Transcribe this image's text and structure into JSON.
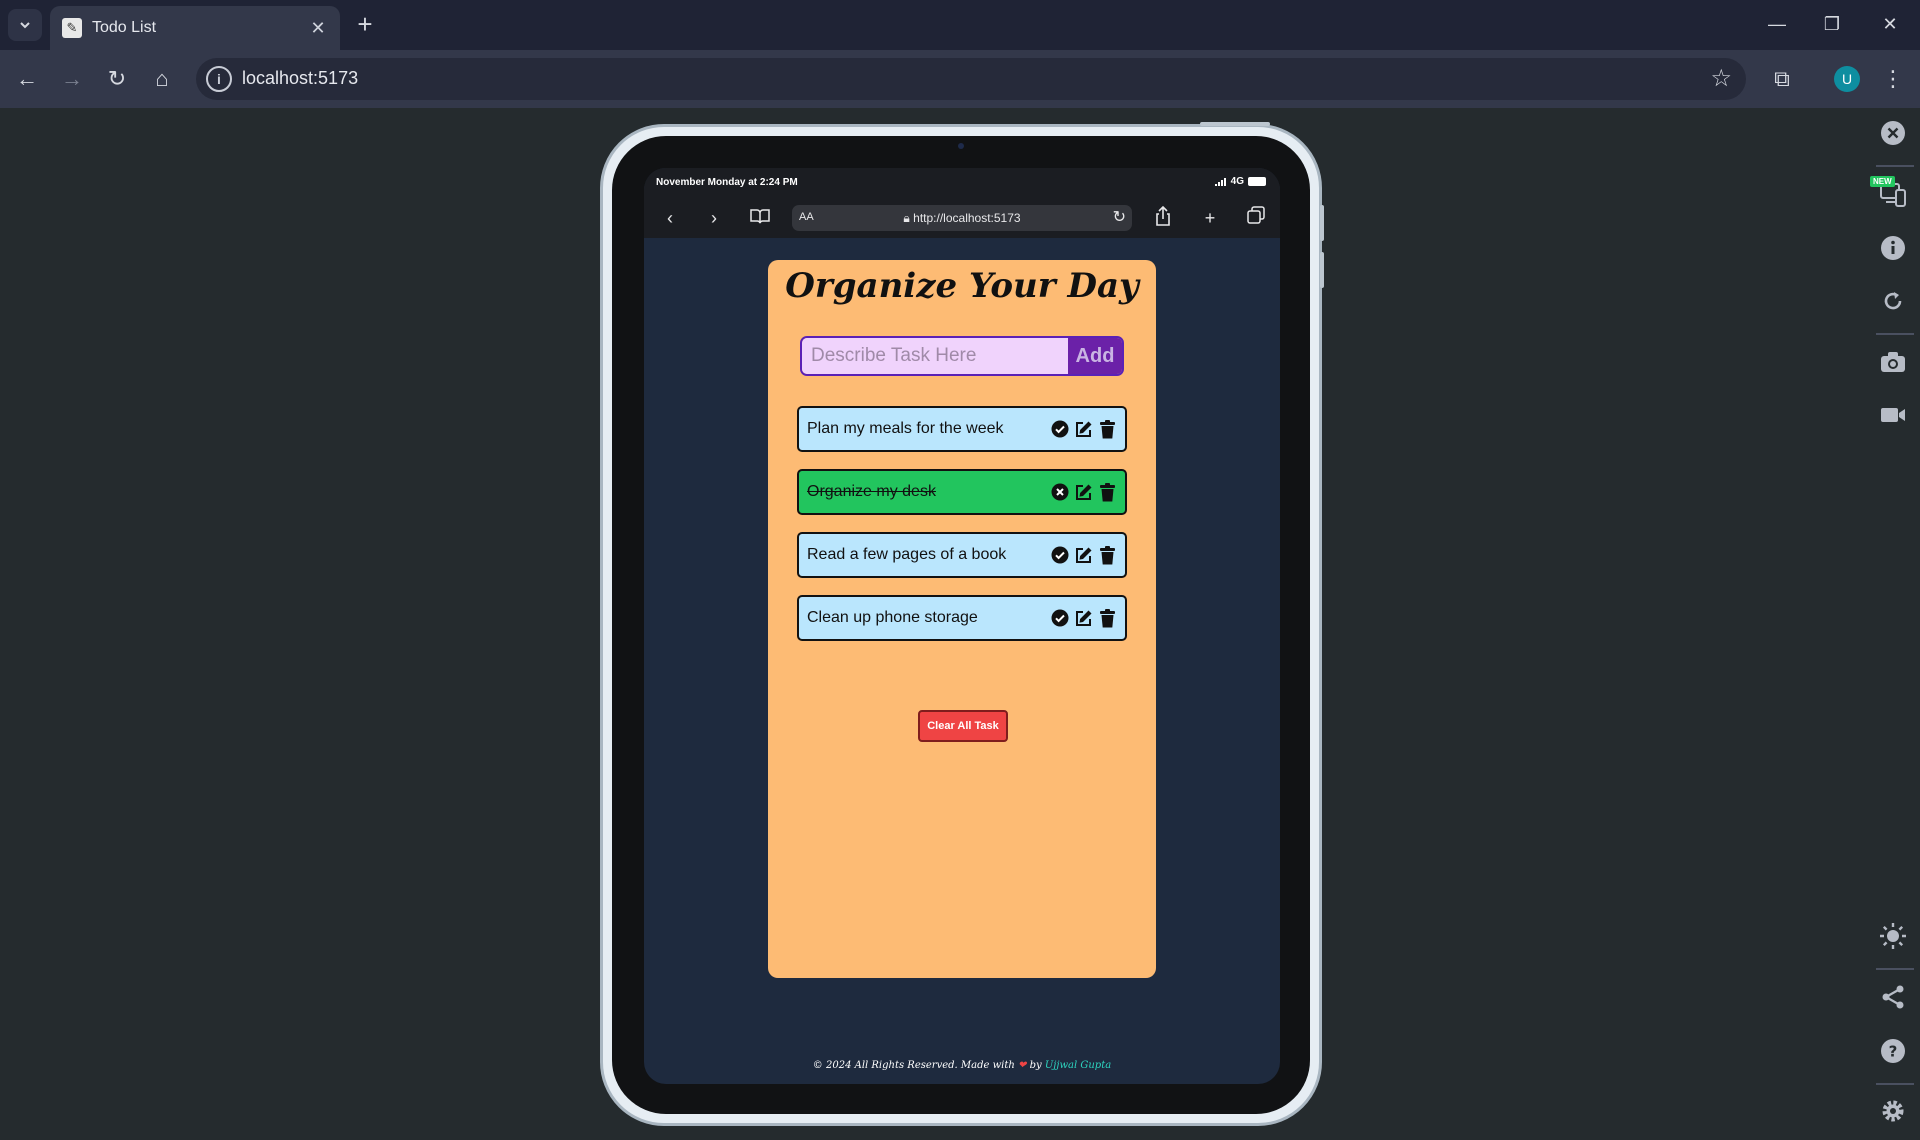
{
  "browser": {
    "tab_title": "Todo List",
    "url": "localhost:5173",
    "avatar_initial": "U"
  },
  "device": {
    "status_time": "November Monday at 2:24 PM",
    "network": "4G",
    "safari_aa": "AA",
    "safari_url": "http://localhost:5173"
  },
  "devtools": {
    "new_badge": "NEW"
  },
  "app": {
    "title": "Organize Your Day",
    "input_placeholder": "Describe Task Here",
    "add_label": "Add",
    "todos": [
      {
        "text": "Plan my meals for the week",
        "completed": false,
        "color": "#bae6fd"
      },
      {
        "text": "Organize my desk",
        "completed": true,
        "color": "#22c55e"
      },
      {
        "text": "Read a few pages of a book",
        "completed": false,
        "color": "#bae6fd"
      },
      {
        "text": "Clean up phone storage",
        "completed": false,
        "color": "#bae6fd"
      }
    ],
    "clear_label": "Clear All Task"
  },
  "footer": {
    "copyright": "© 2024 All Rights Reserved. Made with",
    "heart": "❤",
    "by": "by",
    "author": "Ujjwal Gupta"
  },
  "colors": {
    "card_bg": "#fdbb74",
    "add_button": "#6b21a8",
    "clear_button": "#ef4444",
    "page_bg": "#1e2a3e"
  }
}
